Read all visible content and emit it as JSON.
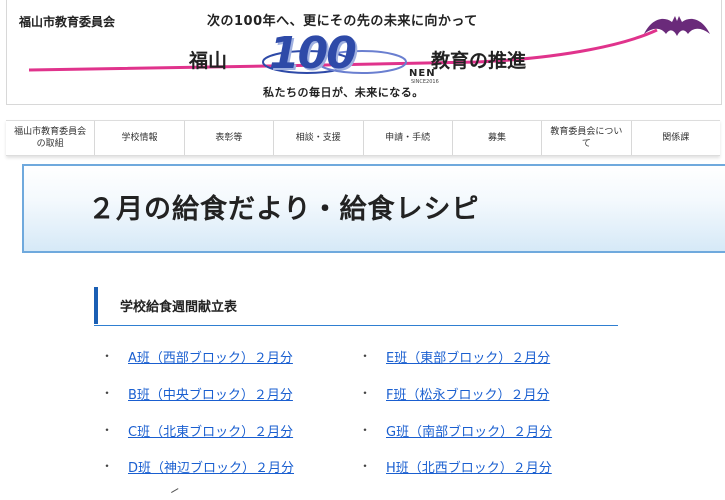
{
  "header": {
    "site_name": "福山市教育委員会",
    "tagline_top": "次の100年へ、更にその先の未来に向かって",
    "tagline_main_left": "福山",
    "tagline_100": "100",
    "tagline_main_right": "教育の推進",
    "tagline_nen": "NEN",
    "tagline_since": "SINCE2016",
    "tagline_bottom": "私たちの毎日が、未来になる。"
  },
  "nav": {
    "items": [
      {
        "label": "福山市教育委員会の取組"
      },
      {
        "label": "学校情報"
      },
      {
        "label": "表彰等"
      },
      {
        "label": "相談・支援"
      },
      {
        "label": "申請・手続"
      },
      {
        "label": "募集"
      },
      {
        "label": "教育委員会について"
      },
      {
        "label": "関係課"
      }
    ]
  },
  "page": {
    "title": "２月の給食だより・給食レシピ"
  },
  "section": {
    "title": "学校給食週間献立表"
  },
  "links": {
    "bullet": "・",
    "left": [
      {
        "label": "A班（西部ブロック）２月分"
      },
      {
        "label": "B班（中央ブロック）２月分"
      },
      {
        "label": "C班（北東ブロック）２月分"
      },
      {
        "label": "D班（神辺ブロック）２月分"
      }
    ],
    "right": [
      {
        "label": "E班（東部ブロック）２月分"
      },
      {
        "label": "F班（松永ブロック）２月分"
      },
      {
        "label": "G班（南部ブロック）２月分"
      },
      {
        "label": "H班（北西ブロック）２月分"
      }
    ]
  },
  "colors": {
    "link": "#1a5fd0",
    "accent_blue": "#1a5fb4",
    "swoosh_magenta": "#e0338c",
    "bat_purple": "#6a2a7a"
  }
}
